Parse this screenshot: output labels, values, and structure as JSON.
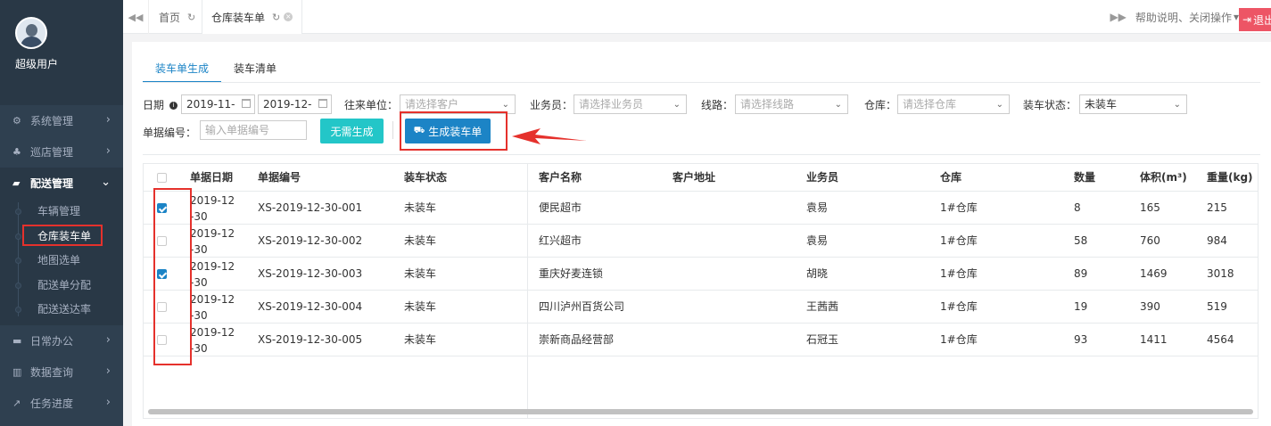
{
  "user": {
    "name": "超级用户"
  },
  "sidebar": {
    "items": [
      {
        "label": "系统管理",
        "icon": "gears-icon",
        "glyph": "⚙"
      },
      {
        "label": "巡店管理",
        "icon": "sitemap-icon",
        "glyph": "♣"
      },
      {
        "label": "配送管理",
        "icon": "truck-icon",
        "glyph": "▰",
        "expanded": true
      },
      {
        "label": "日常办公",
        "icon": "briefcase-icon",
        "glyph": "▬"
      },
      {
        "label": "数据查询",
        "icon": "bar-chart-icon",
        "glyph": "▥"
      },
      {
        "label": "任务进度",
        "icon": "line-chart-icon",
        "glyph": "↗"
      }
    ],
    "submenu": [
      "车辆管理",
      "仓库装车单",
      "地图选单",
      "配送单分配",
      "配送送达率"
    ]
  },
  "topbar": {
    "tabs": [
      {
        "label": "首页"
      },
      {
        "label": "仓库装车单"
      }
    ],
    "help": "帮助说明",
    "close_ops": "关闭操作",
    "logout": "退出"
  },
  "subtabs": [
    "装车单生成",
    "装车清单"
  ],
  "filters": {
    "date_label": "日期",
    "date_from": "2019-11-",
    "date_to": "2019-12-",
    "partner_label": "往来单位：",
    "partner_placeholder": "请选择客户",
    "salesman_label": "业务员：",
    "salesman_placeholder": "请选择业务员",
    "route_label": "线路：",
    "route_placeholder": "请选择线路",
    "warehouse_label": "仓库：",
    "warehouse_placeholder": "请选择仓库",
    "status_label": "装车状态：",
    "status_value": "未装车",
    "docno_label": "单据编号：",
    "docno_placeholder": "输入单据编号",
    "btn_skip": "无需生成",
    "btn_generate": "生成装车单"
  },
  "table": {
    "columns": [
      "单据日期",
      "单据编号",
      "装车状态",
      "客户名称",
      "客户地址",
      "业务员",
      "仓库",
      "数量",
      "体积(m³)",
      "重量(kg)"
    ],
    "rows": [
      {
        "checked": true,
        "date1": "2019-12",
        "date2": "-30",
        "no": "XS-2019-12-30-001",
        "status": "未装车",
        "customer": "便民超市",
        "address": "",
        "salesman": "袁易",
        "warehouse": "1#仓库",
        "qty": "8",
        "volume": "165",
        "weight": "215"
      },
      {
        "checked": false,
        "date1": "2019-12",
        "date2": "-30",
        "no": "XS-2019-12-30-002",
        "status": "未装车",
        "customer": "红兴超市",
        "address": "",
        "salesman": "袁易",
        "warehouse": "1#仓库",
        "qty": "58",
        "volume": "760",
        "weight": "984"
      },
      {
        "checked": true,
        "date1": "2019-12",
        "date2": "-30",
        "no": "XS-2019-12-30-003",
        "status": "未装车",
        "customer": "重庆好麦连锁",
        "address": "",
        "salesman": "胡晓",
        "warehouse": "1#仓库",
        "qty": "89",
        "volume": "1469",
        "weight": "3018"
      },
      {
        "checked": false,
        "date1": "2019-12",
        "date2": "-30",
        "no": "XS-2019-12-30-004",
        "status": "未装车",
        "customer": "四川泸州百货公司",
        "address": "",
        "salesman": "王茜茜",
        "warehouse": "1#仓库",
        "qty": "19",
        "volume": "390",
        "weight": "519"
      },
      {
        "checked": false,
        "date1": "2019-12",
        "date2": "-30",
        "no": "XS-2019-12-30-005",
        "status": "未装车",
        "customer": "崇新商品经营部",
        "address": "",
        "salesman": "石冠玉",
        "warehouse": "1#仓库",
        "qty": "93",
        "volume": "1411",
        "weight": "4564"
      }
    ]
  },
  "colors": {
    "sidebar": "#2f4050",
    "primary": "#1c84c6",
    "teal": "#23c6c8",
    "annotation": "#e5312c",
    "logout": "#ed5565"
  }
}
